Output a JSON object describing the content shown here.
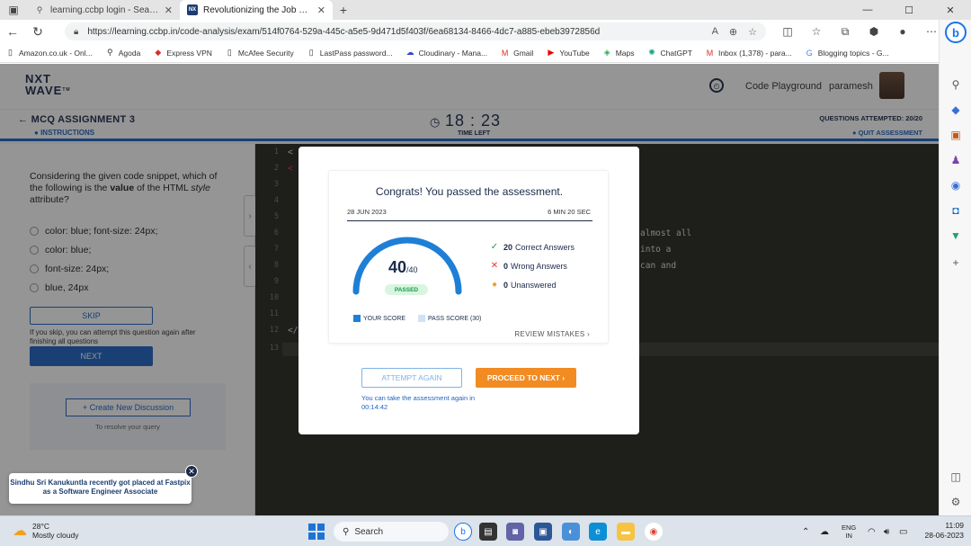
{
  "browser": {
    "tabs": [
      {
        "title": "learning.ccbp login - Search",
        "active": false
      },
      {
        "title": "Revolutionizing the Job Market |",
        "active": true
      }
    ],
    "url": "https://learning.ccbp.in/code-analysis/exam/514f0764-529a-445c-a5e5-9d471d5f403f/6ea68134-8466-4dc7-a885-ebeb3972856d",
    "bookmarks": [
      "Amazon.co.uk - Onl...",
      "Agoda",
      "Express VPN",
      "McAfee Security",
      "LastPass password...",
      "Cloudinary - Mana...",
      "Gmail",
      "YouTube",
      "Maps",
      "ChatGPT",
      "Inbox (1,378) - para...",
      "Blogging topics - G..."
    ]
  },
  "header": {
    "logo_line1": "NXT",
    "logo_line2": "WAVE",
    "logo_tm": "TM",
    "code_playground": "Code Playground",
    "username": "paramesh"
  },
  "exam": {
    "title": "MCQ ASSIGNMENT 3",
    "instructions": "INSTRUCTIONS",
    "timer": "18 : 23",
    "time_left": "TIME LEFT",
    "questions_attempted": "QUESTIONS ATTEMPTED: 20/20",
    "quit": "QUIT ASSESSMENT"
  },
  "question": {
    "text_pre": "Considering the given code snippet, which of the following is the ",
    "text_bold": "value",
    "text_mid": " of the HTML ",
    "text_italic": "style",
    "text_post": " attribute?",
    "options": [
      "color: blue; font-size: 24px;",
      "color: blue;",
      "font-size: 24px;",
      "blue, 24px"
    ],
    "skip": "SKIP",
    "skip_note": "If you skip, you can attempt this question again after finishing all questions",
    "next": "NEXT",
    "create_discussion": "+ Create New Discussion",
    "resolve": "To resolve your query"
  },
  "editor": {
    "line_numbers": [
      "1",
      "2",
      "3",
      "4",
      "5",
      "6",
      "7",
      "8",
      "9",
      "10",
      "11",
      "12",
      "13"
    ],
    "visible_code": {
      "l1": "<",
      "l2": "<",
      "l12": "</",
      "l6": "almost all",
      "l7": "into a",
      "l8": "can and"
    }
  },
  "modal": {
    "congrats": "Congrats! You passed the assessment.",
    "date": "28 JUN 2023",
    "duration": "6 MIN 20 SEC",
    "score": "40",
    "score_total": "/40",
    "status": "PASSED",
    "correct_count": "20",
    "correct_label": "Correct Answers",
    "wrong_count": "0",
    "wrong_label": "Wrong Answers",
    "unanswered_count": "0",
    "unanswered_label": "Unanswered",
    "legend_your": "YOUR SCORE",
    "legend_pass": "PASS SCORE (30)",
    "review": "REVIEW MISTAKES",
    "attempt_again": "ATTEMPT AGAIN",
    "proceed": "PROCEED TO NEXT",
    "retake_note": "You can take the assessment again in 00:14:42",
    "score_fraction": 1.0,
    "colors": {
      "accent": "#1e63c5",
      "gauge": "#1e7fd6",
      "proceed": "#f28b22",
      "passed_text": "#1c9a4a"
    }
  },
  "toast": {
    "text": "Sindhu Sri Kanukuntla recently got placed at Fastpix as a Software Engineer Associate"
  },
  "taskbar": {
    "temp": "28°C",
    "weather": "Mostly cloudy",
    "search": "Search",
    "lang1": "ENG",
    "lang2": "IN",
    "time": "11:09",
    "date": "28-06-2023"
  }
}
